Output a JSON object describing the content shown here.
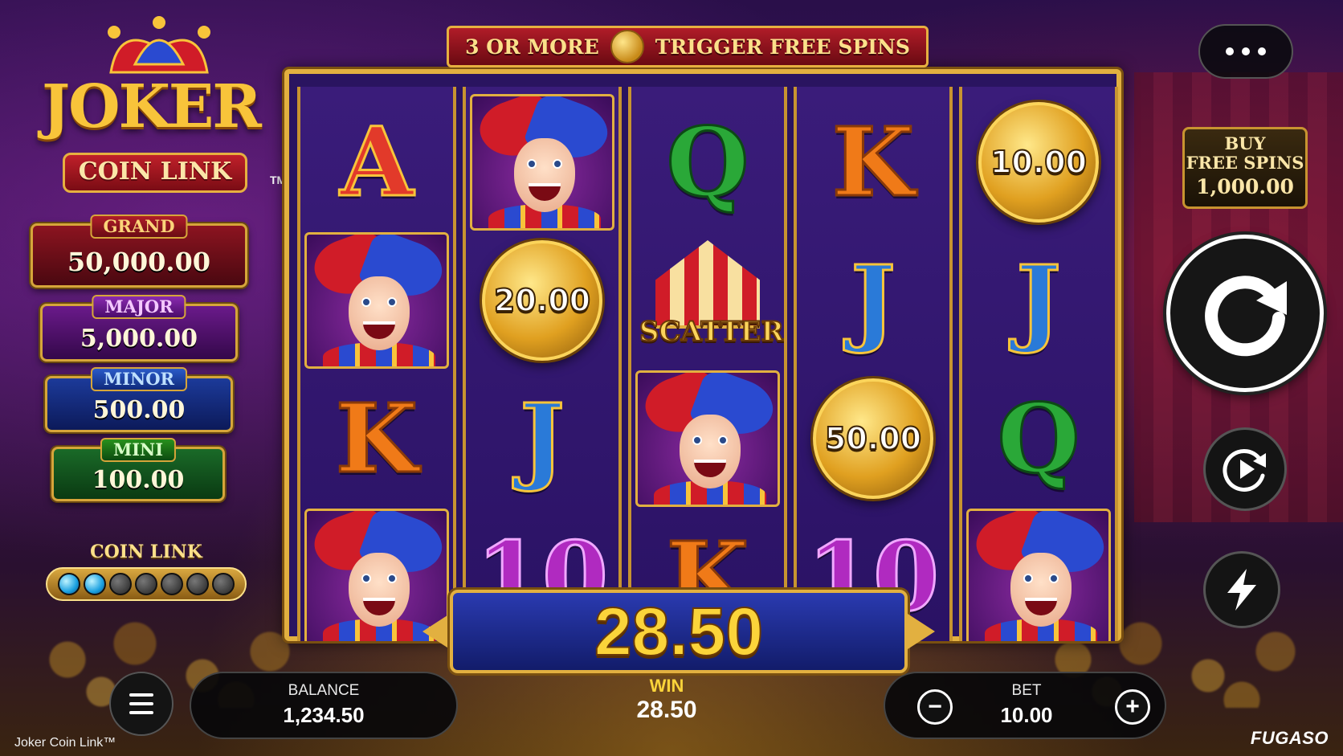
{
  "logo": {
    "title": "JOKER",
    "subtitle": "COIN LINK",
    "tm": "TM"
  },
  "jackpots": [
    {
      "label": "GRAND",
      "value": "50,000.00"
    },
    {
      "label": "MAJOR",
      "value": "5,000.00"
    },
    {
      "label": "MINOR",
      "value": "500.00"
    },
    {
      "label": "MINI",
      "value": "100.00"
    }
  ],
  "coin_link": {
    "label": "COIN LINK",
    "lit_gems": 2,
    "total_gems": 7
  },
  "banner": {
    "left": "3 OR MORE",
    "right": "TRIGGER FREE SPINS"
  },
  "reels": [
    [
      {
        "type": "letter",
        "value": "A"
      },
      {
        "type": "joker"
      },
      {
        "type": "letter",
        "value": "K"
      },
      {
        "type": "joker"
      }
    ],
    [
      {
        "type": "joker"
      },
      {
        "type": "coin",
        "value": "20.00"
      },
      {
        "type": "letter",
        "value": "J"
      },
      {
        "type": "letter",
        "value": "10"
      }
    ],
    [
      {
        "type": "letter",
        "value": "Q"
      },
      {
        "type": "scatter",
        "value": "SCATTER"
      },
      {
        "type": "joker"
      },
      {
        "type": "letter",
        "value": "K"
      }
    ],
    [
      {
        "type": "letter",
        "value": "K"
      },
      {
        "type": "letter",
        "value": "J"
      },
      {
        "type": "coin",
        "value": "50.00"
      },
      {
        "type": "letter",
        "value": "10"
      }
    ],
    [
      {
        "type": "coin",
        "value": "10.00"
      },
      {
        "type": "letter",
        "value": "J"
      },
      {
        "type": "letter",
        "value": "Q"
      },
      {
        "type": "joker"
      }
    ]
  ],
  "win_display": "28.50",
  "controls": {
    "buy_line1": "BUY",
    "buy_line2": "FREE SPINS",
    "buy_price": "1,000.00"
  },
  "bottom": {
    "balance_label": "BALANCE",
    "balance_value": "1,234.50",
    "win_label": "WIN",
    "win_value": "28.50",
    "bet_label": "BET",
    "bet_value": "10.00",
    "minus": "−",
    "plus": "+"
  },
  "footer": {
    "game_name": "Joker Coin Link™",
    "provider": "FUGASO"
  }
}
